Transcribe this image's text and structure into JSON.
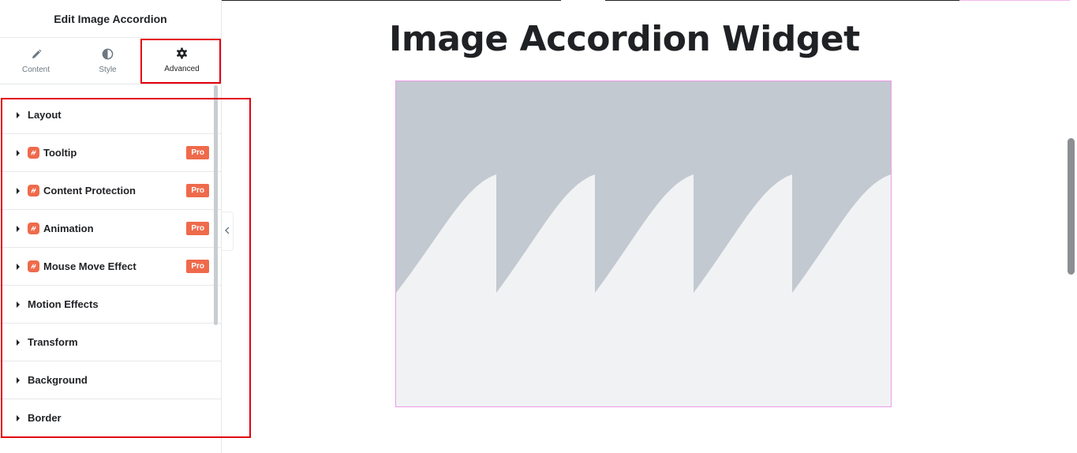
{
  "panel": {
    "title": "Edit Image Accordion",
    "tabs": [
      {
        "label": "Content",
        "icon": "pencil-icon",
        "active": false
      },
      {
        "label": "Style",
        "icon": "half-circle-icon",
        "active": false
      },
      {
        "label": "Advanced",
        "icon": "gear-icon",
        "active": true
      }
    ],
    "sections": [
      {
        "label": "Layout",
        "pro": false
      },
      {
        "label": "Tooltip",
        "pro": true,
        "badge": "Pro"
      },
      {
        "label": "Content Protection",
        "pro": true,
        "badge": "Pro"
      },
      {
        "label": "Animation",
        "pro": true,
        "badge": "Pro"
      },
      {
        "label": "Mouse Move Effect",
        "pro": true,
        "badge": "Pro"
      },
      {
        "label": "Motion Effects",
        "pro": false
      },
      {
        "label": "Transform",
        "pro": false
      },
      {
        "label": "Background",
        "pro": false
      },
      {
        "label": "Border",
        "pro": false
      }
    ],
    "collapse_icon": "chevron-left-icon"
  },
  "canvas": {
    "heading": "Image Accordion Widget",
    "widget_placeholder": "image-placeholder"
  },
  "colors": {
    "highlight": "#e3000f",
    "pro_accent": "#ef6a4b",
    "widget_border": "#ee9be8",
    "placeholder_dark": "#c3c9d0",
    "placeholder_light": "#f1f2f4"
  }
}
